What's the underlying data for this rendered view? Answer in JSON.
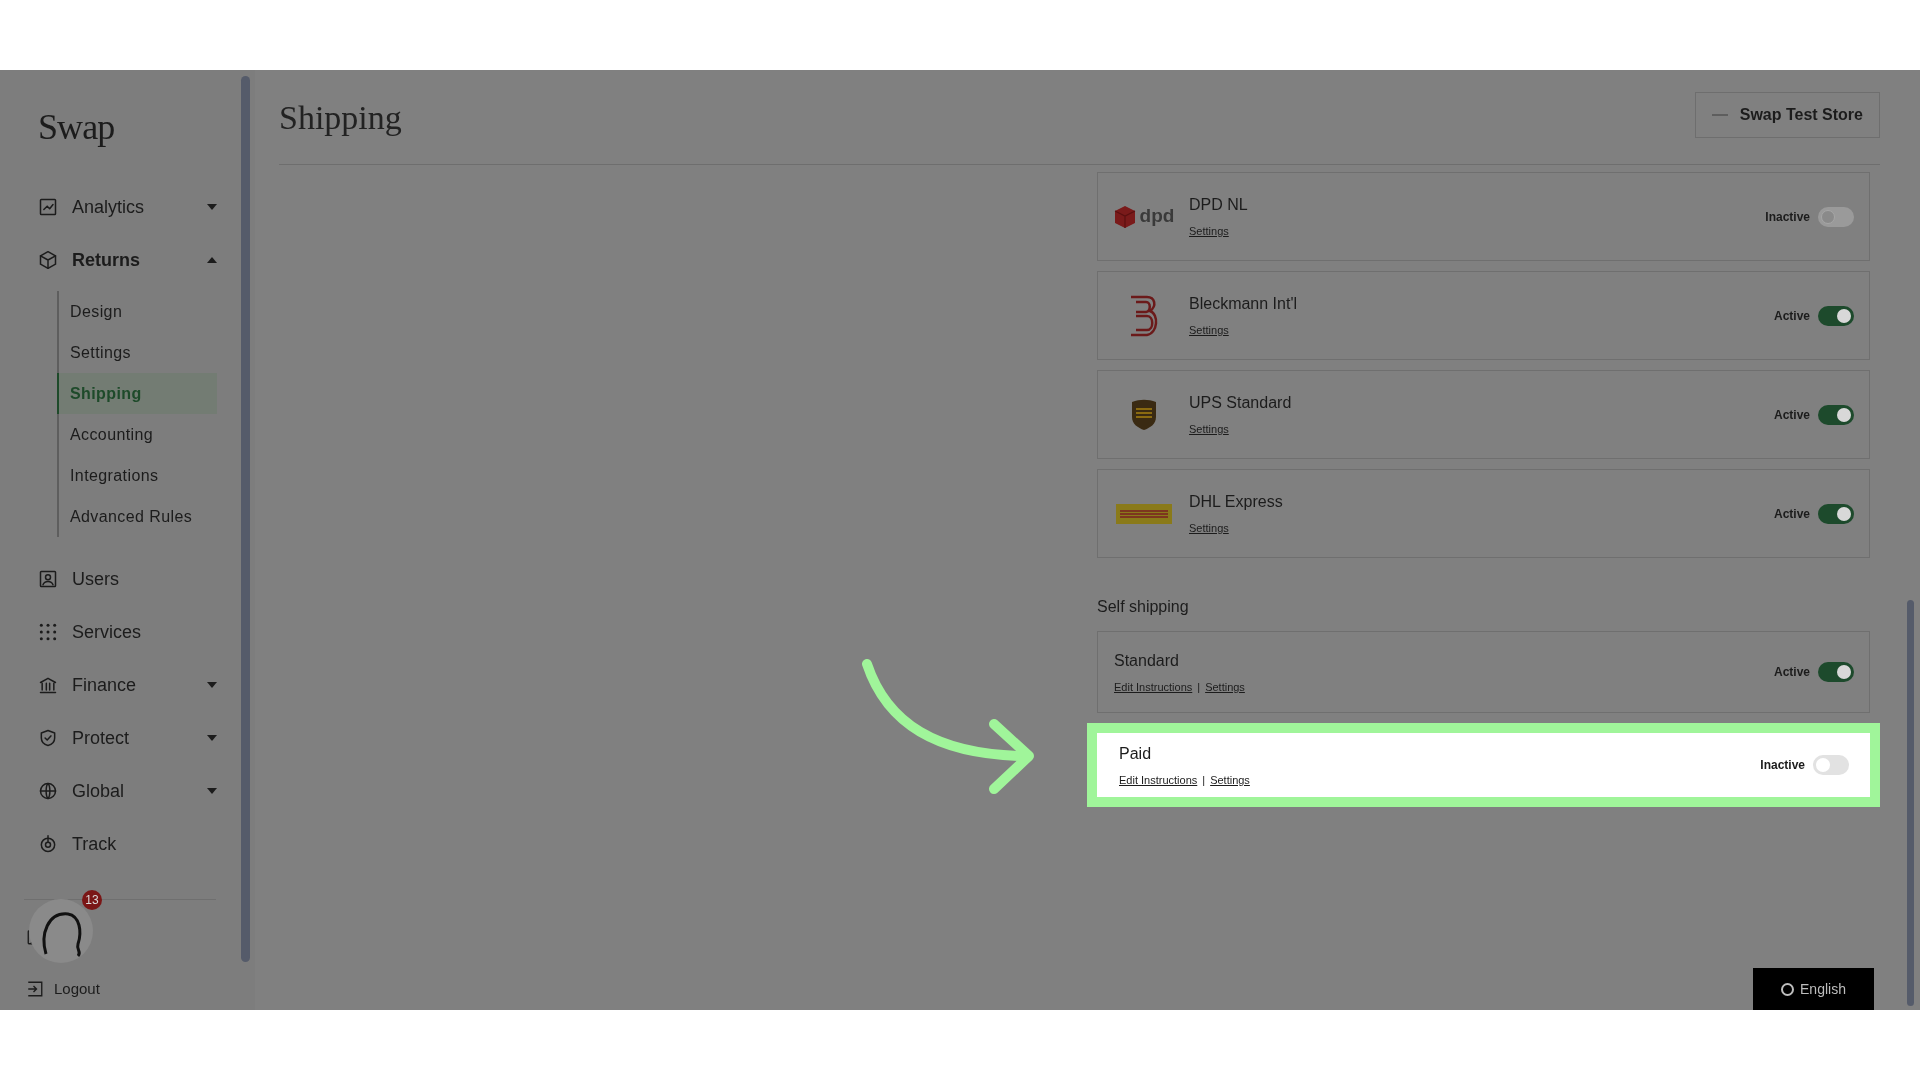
{
  "sidebar": {
    "logo": "Swap",
    "items": [
      {
        "label": "Analytics",
        "expanded": false
      },
      {
        "label": "Returns",
        "expanded": true,
        "children": [
          {
            "label": "Design",
            "selected": false
          },
          {
            "label": "Settings",
            "selected": false
          },
          {
            "label": "Shipping",
            "selected": true
          },
          {
            "label": "Accounting",
            "selected": false
          },
          {
            "label": "Integrations",
            "selected": false
          },
          {
            "label": "Advanced Rules",
            "selected": false
          }
        ]
      },
      {
        "label": "Users"
      },
      {
        "label": "Services"
      },
      {
        "label": "Finance",
        "expanded": false
      },
      {
        "label": "Protect",
        "expanded": false
      },
      {
        "label": "Global",
        "expanded": false
      },
      {
        "label": "Track"
      }
    ],
    "logout": "Logout",
    "chat_badge": "13"
  },
  "page": {
    "title": "Shipping",
    "store_button": "Swap Test Store"
  },
  "carriers": [
    {
      "name": "DPD NL",
      "logo_text": "dpd",
      "link": "Settings",
      "status": "Inactive",
      "active": false
    },
    {
      "name": "Bleckmann Int'l",
      "link": "Settings",
      "status": "Active",
      "active": true
    },
    {
      "name": "UPS Standard",
      "link": "Settings",
      "status": "Active",
      "active": true
    },
    {
      "name": "DHL Express",
      "link": "Settings",
      "status": "Active",
      "active": true
    }
  ],
  "self_shipping": {
    "heading": "Self shipping",
    "methods": [
      {
        "name": "Standard",
        "links": [
          "Edit Instructions",
          "Settings"
        ],
        "separator": "|",
        "status": "Active",
        "active": true,
        "highlighted": false
      },
      {
        "name": "Paid",
        "links": [
          "Edit Instructions",
          "Settings"
        ],
        "separator": "|",
        "status": "Inactive",
        "active": false,
        "highlighted": true
      }
    ]
  },
  "language_button": "English"
}
